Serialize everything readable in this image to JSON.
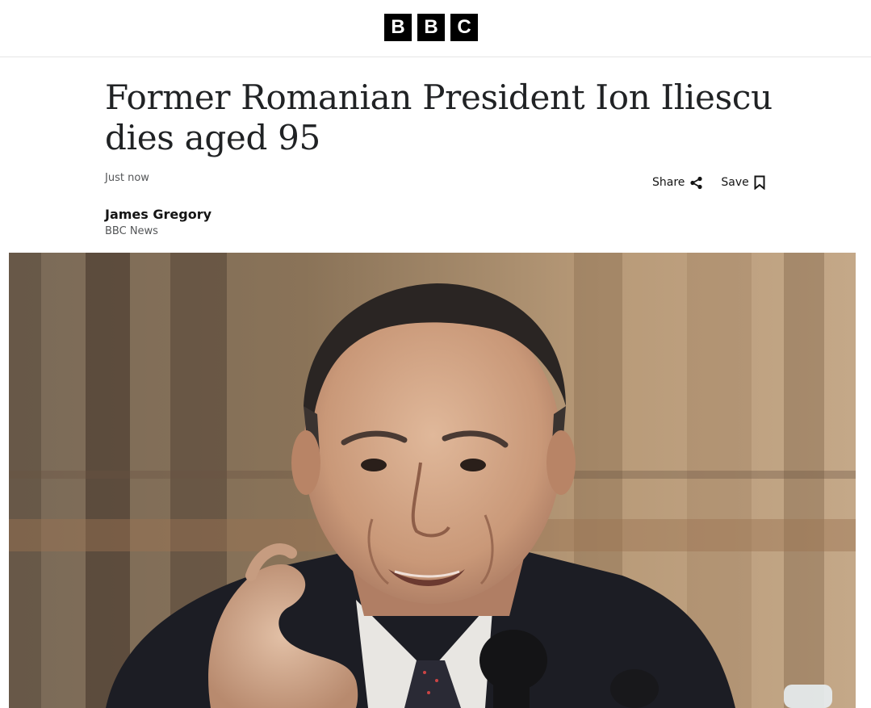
{
  "header": {
    "logo_letters": [
      "B",
      "B",
      "C"
    ]
  },
  "article": {
    "headline": "Former Romanian President Ion Iliescu dies aged 95",
    "timestamp": "Just now",
    "byline": {
      "name": "James Gregory",
      "organization": "BBC News"
    },
    "actions": {
      "share_label": "Share",
      "save_label": "Save"
    },
    "hero_image": {
      "subject": "Ion Iliescu speaking at a press conference microphone"
    }
  },
  "icons": {
    "share": "share-icon",
    "save": "bookmark-icon"
  }
}
